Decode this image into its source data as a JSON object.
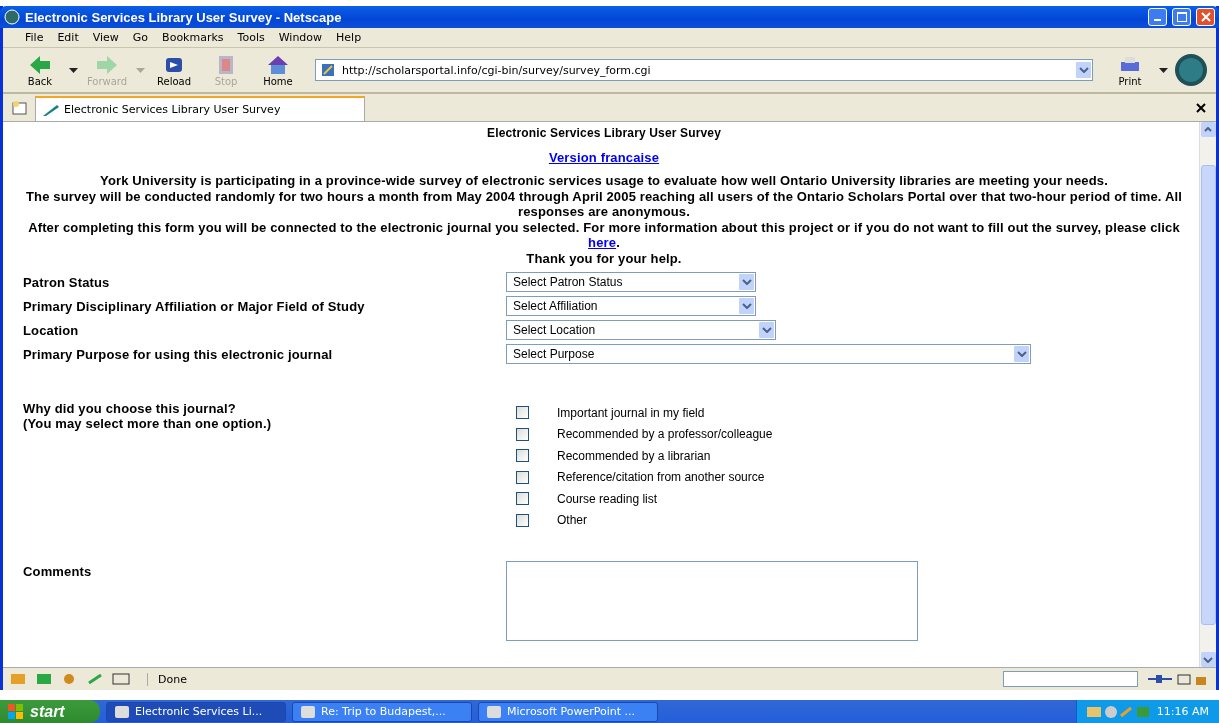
{
  "window": {
    "title": "Electronic Services Library User Survey - Netscape"
  },
  "menu": [
    "File",
    "Edit",
    "View",
    "Go",
    "Bookmarks",
    "Tools",
    "Window",
    "Help"
  ],
  "toolbar": [
    {
      "kind": "back",
      "label": "Back",
      "disabled": false
    },
    {
      "kind": "forward",
      "label": "Forward",
      "disabled": true
    },
    {
      "kind": "reload",
      "label": "Reload",
      "disabled": false
    },
    {
      "kind": "stop",
      "label": "Stop",
      "disabled": true
    },
    {
      "kind": "home",
      "label": "Home",
      "disabled": false
    }
  ],
  "address": {
    "value": "http://scholarsportal.info/cgi-bin/survey/survey_form.cgi"
  },
  "print": {
    "label": "Print"
  },
  "tabs": [
    {
      "label": "Electronic Services Library User Survey",
      "selected": true
    }
  ],
  "page": {
    "heading": "Electronic Services Library User Survey",
    "language_link": "Version francaise",
    "paragraphs": [
      {
        "text": "York University is participating in a province-wide survey of electronic services usage to evaluate how well Ontario University libraries are meeting your needs."
      },
      {
        "text": "The survey will be conducted randomly for two hours a month from May 2004 through April 2005 reaching all users of the Ontario Scholars Portal over that two-hour period of time. All responses are anonymous."
      },
      {
        "text": "After completing this form you will be connected to the electronic journal you selected. For more information about this project or if you do not want to fill out the survey, please click ",
        "link": "here",
        "after": "."
      },
      {
        "text": "Thank you for your help."
      }
    ],
    "fields": [
      {
        "kind": "select",
        "label": "Patron Status",
        "value": "Select Patron Status"
      },
      {
        "kind": "select",
        "label": "Primary Disciplinary Affiliation or Major Field of Study",
        "value": "Select Affiliation"
      },
      {
        "kind": "select",
        "label": "Location",
        "value": "Select Location"
      },
      {
        "kind": "select",
        "label": "Primary Purpose for using this electronic journal",
        "value": "Select Purpose"
      },
      {
        "kind": "checkboxes",
        "label": "Why did you choose this journal?",
        "note": "(You may select more than one option.)",
        "options": [
          {
            "label": "Important journal in my field",
            "checked": false
          },
          {
            "label": "Recommended by a professor/colleague",
            "checked": false
          },
          {
            "label": "Recommended by a librarian",
            "checked": false
          },
          {
            "label": "Reference/citation from another source",
            "checked": false
          },
          {
            "label": "Course reading list",
            "checked": false
          },
          {
            "label": "Other",
            "checked": false
          }
        ]
      },
      {
        "kind": "textarea",
        "label": "Comments"
      }
    ]
  },
  "status_bar": {
    "text": "Done"
  },
  "taskbar": {
    "start": "start",
    "items": [
      {
        "label": "Electronic Services Li...",
        "selected": true
      },
      {
        "label": "Re: Trip to Budapest,...",
        "selected": false
      },
      {
        "label": "Microsoft PowerPoint ...",
        "selected": false
      }
    ],
    "clock": "11:16 AM"
  }
}
